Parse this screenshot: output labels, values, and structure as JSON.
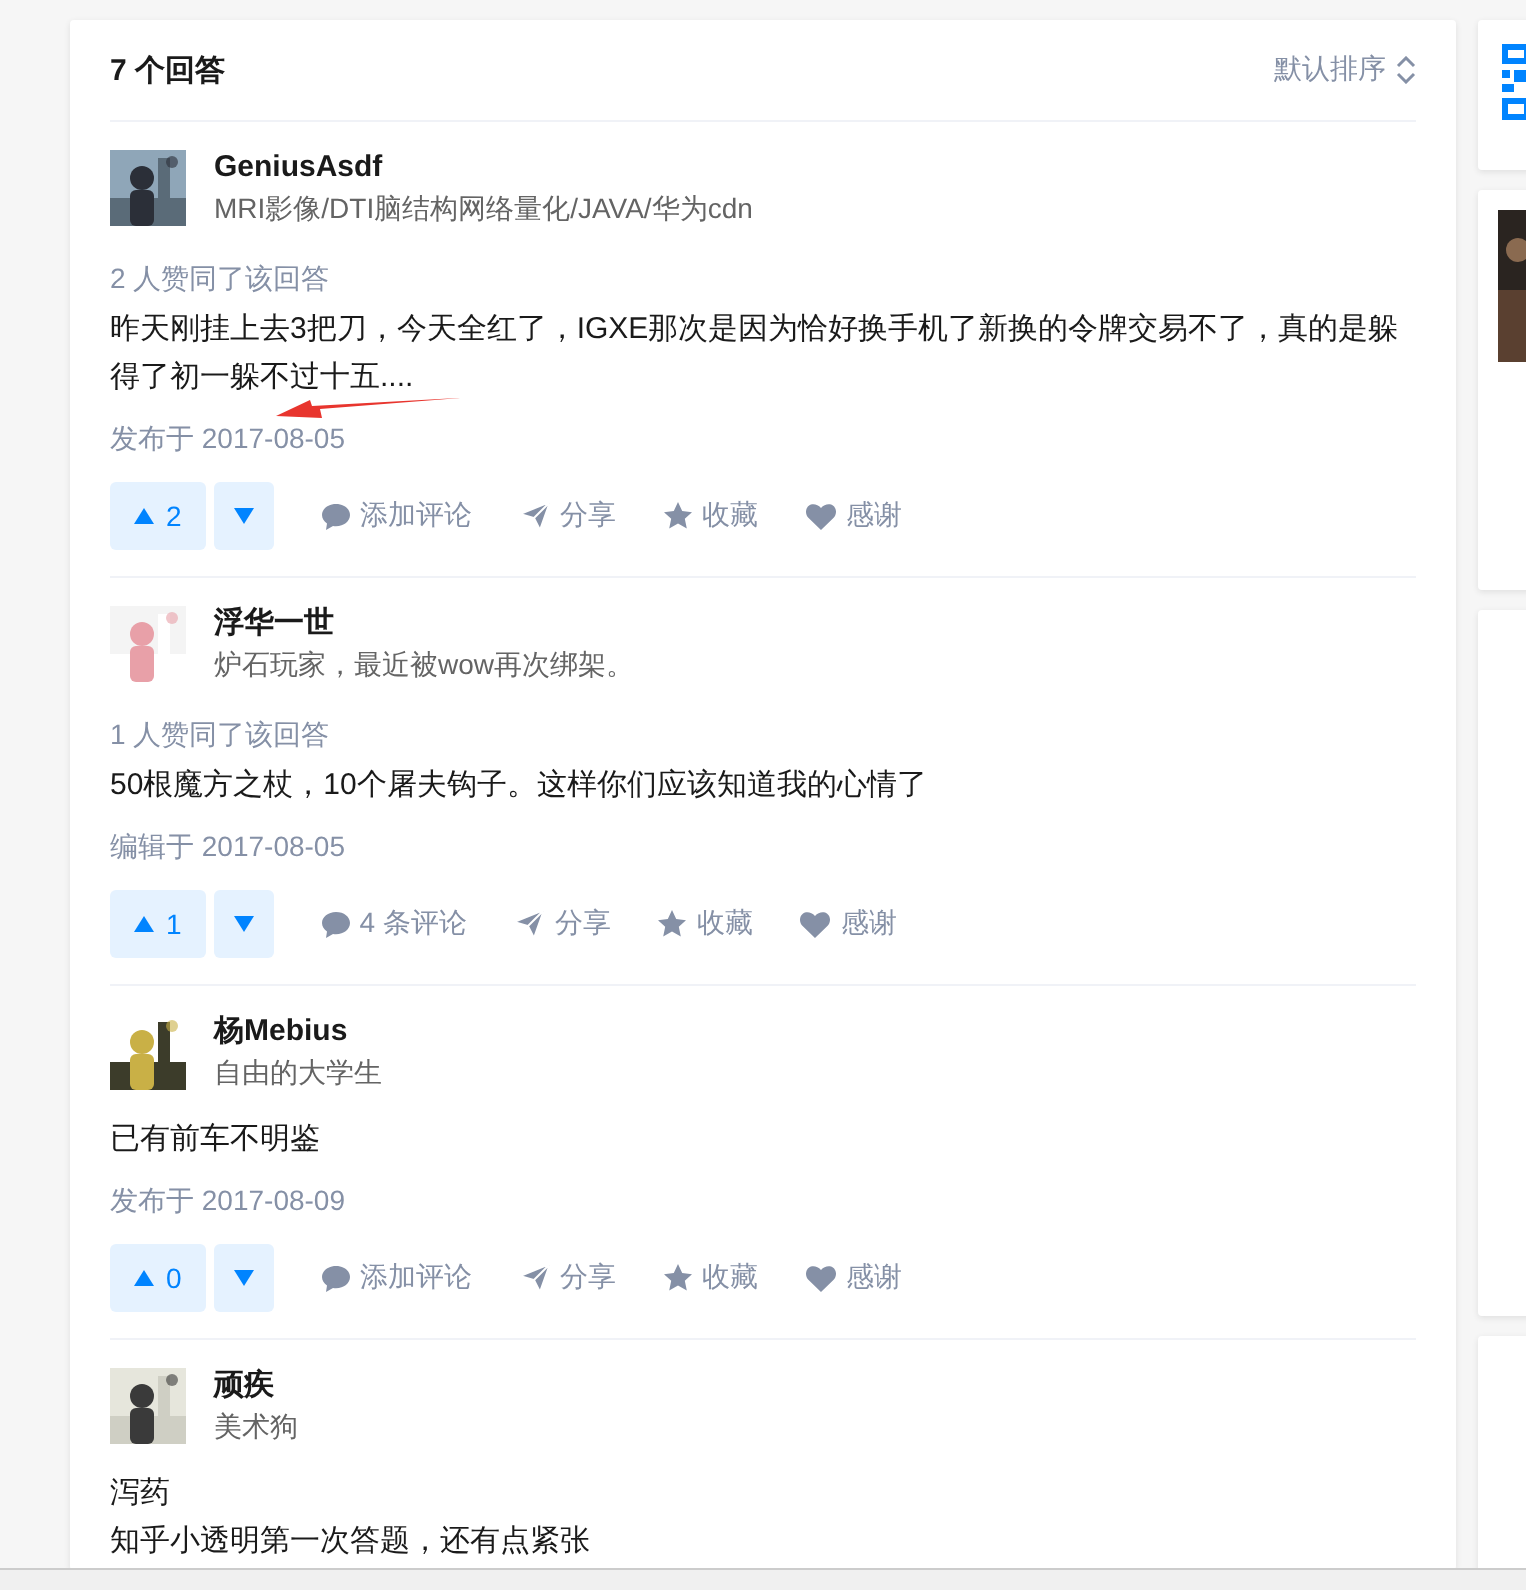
{
  "answers_header": {
    "title": "7 个回答",
    "sort": "默认排序"
  },
  "answers": [
    {
      "author": {
        "name": "GeniusAsdf",
        "bio": "MRI影像/DTI脑结构网络量化/JAVA/华为cdn"
      },
      "upvote_note": "2 人赞同了该回答",
      "content": [
        "昨天刚挂上去3把刀，今天全红了，IGXE那次是因为恰好换手机了新换的令牌交易不了，真的是躲得了初一躲不过十五...."
      ],
      "date": "发布于 2017-08-05",
      "votes": "2",
      "actions": [
        {
          "kind": "comment",
          "label": "添加评论"
        },
        {
          "kind": "share",
          "label": "分享"
        },
        {
          "kind": "favorite",
          "label": "收藏"
        },
        {
          "kind": "thanks",
          "label": "感谢"
        }
      ]
    },
    {
      "author": {
        "name": "浮华一世",
        "bio": "炉石玩家，最近被wow再次绑架。"
      },
      "upvote_note": "1 人赞同了该回答",
      "content": [
        "50根魔方之杖，10个屠夫钩子。这样你们应该知道我的心情了"
      ],
      "date": "编辑于 2017-08-05",
      "votes": "1",
      "actions": [
        {
          "kind": "comment",
          "label": "4 条评论"
        },
        {
          "kind": "share",
          "label": "分享"
        },
        {
          "kind": "favorite",
          "label": "收藏"
        },
        {
          "kind": "thanks",
          "label": "感谢"
        }
      ]
    },
    {
      "author": {
        "name": "杨Mebius",
        "bio": "自由的大学生"
      },
      "content": [
        "已有前车不明鉴"
      ],
      "date": "发布于 2017-08-09",
      "votes": "0",
      "actions": [
        {
          "kind": "comment",
          "label": "添加评论"
        },
        {
          "kind": "share",
          "label": "分享"
        },
        {
          "kind": "favorite",
          "label": "收藏"
        },
        {
          "kind": "thanks",
          "label": "感谢"
        }
      ]
    },
    {
      "author": {
        "name": "顽疾",
        "bio": "美术狗"
      },
      "content": [
        "泻药",
        "知乎小透明第一次答题，还有点紧张"
      ]
    }
  ]
}
